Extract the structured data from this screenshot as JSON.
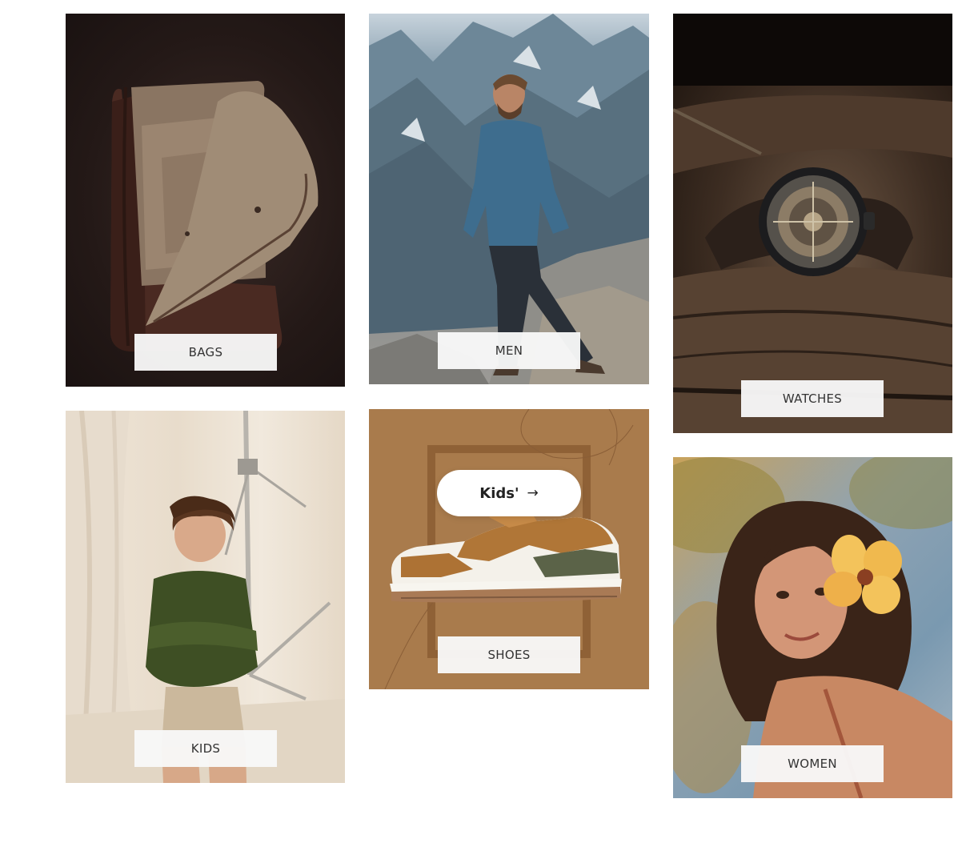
{
  "categories": [
    {
      "id": "bags",
      "label": "BAGS"
    },
    {
      "id": "men",
      "label": "MEN"
    },
    {
      "id": "watches",
      "label": "WATCHES"
    },
    {
      "id": "kids",
      "label": "KIDS"
    },
    {
      "id": "shoes",
      "label": "SHOES"
    },
    {
      "id": "women",
      "label": "WOMEN"
    }
  ],
  "shoes_promo": {
    "pill_label": "Kids'",
    "arrow_icon": "arrow-right-icon"
  },
  "colors": {
    "shoes_bg": "#a97b4c",
    "label_bg": "#f8f8f8",
    "label_text": "#333333"
  }
}
